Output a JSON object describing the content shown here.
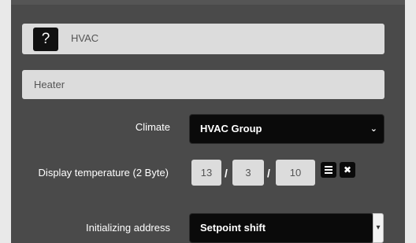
{
  "header": {
    "help_label": "?",
    "title_value": "HVAC"
  },
  "name": {
    "value": "Heater"
  },
  "climate": {
    "label": "Climate",
    "selected": "HVAC Group",
    "caret": "⌄"
  },
  "display_temperature": {
    "label": "Display temperature (2 Byte)",
    "parts": [
      "13",
      "3",
      "10"
    ],
    "separator": "/",
    "list_icon": "list-icon",
    "clear_label": "✖"
  },
  "initializing_address": {
    "label": "Initializing address",
    "selected": "Setpoint shift",
    "caret": "▾"
  }
}
